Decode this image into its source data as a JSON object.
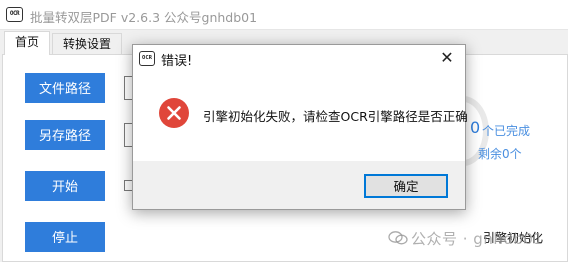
{
  "main_window": {
    "title": "批量转双层PDF v2.6.3 公众号gnhdb01",
    "icon_label": "OCR",
    "icon": "ocr-app-icon"
  },
  "tabs": [
    {
      "label": "首页",
      "active": true
    },
    {
      "label": "转换设置",
      "active": false
    }
  ],
  "buttons": {
    "file_path": "文件路径",
    "save_path": "另存路径",
    "start": "开始",
    "stop": "停止"
  },
  "status": {
    "done_count": "0",
    "done_label": "个已完成",
    "remaining_label": "剩余0个",
    "engine": "引擎初始化"
  },
  "dialog": {
    "title": "错误!",
    "icon_label": "OCR",
    "close_symbol": "✕",
    "message": "引擎初始化失败，请检查OCR引擎路径是否正确",
    "ok_label": "确定",
    "error_icon": "error-x-icon"
  },
  "watermark": {
    "text": "公众号 · gnhdb01"
  },
  "colors": {
    "primary_button": "#2f7ddb",
    "error_red": "#e0463a",
    "focus_border": "#0078d7"
  }
}
